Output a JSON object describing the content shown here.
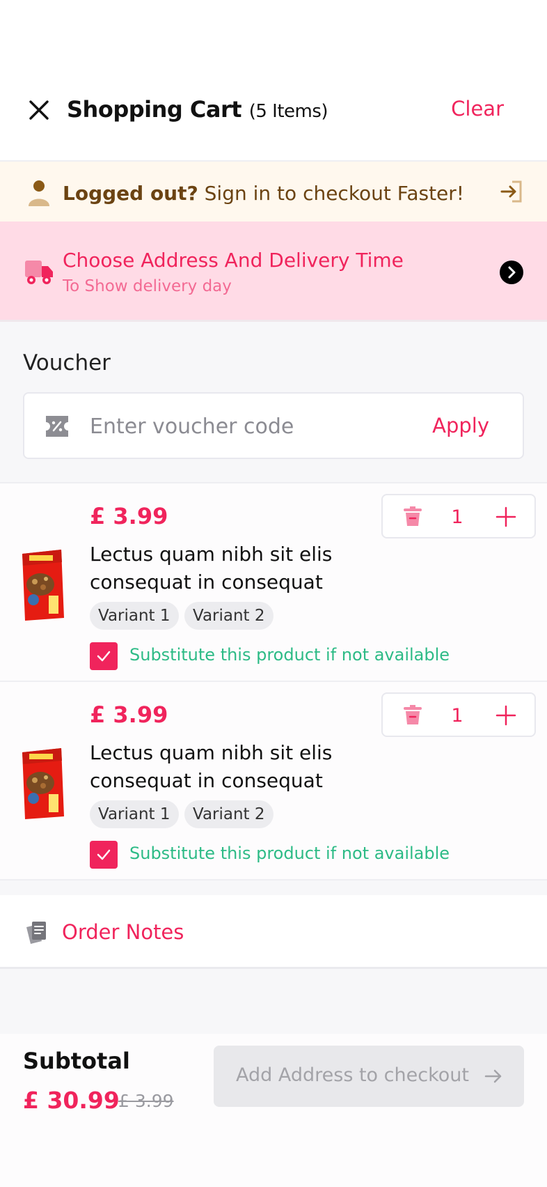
{
  "header": {
    "title": "Shopping Cart",
    "count": "(5 Items)",
    "clear_label": "Clear"
  },
  "login_banner": {
    "bold_text": "Logged out?",
    "text": "Sign in to checkout Faster!"
  },
  "delivery_banner": {
    "title": "Choose Address And Delivery Time",
    "subtitle": "To Show delivery day"
  },
  "voucher": {
    "label": "Voucher",
    "placeholder": "Enter voucher code",
    "apply_label": "Apply"
  },
  "items": [
    {
      "price": "£ 3.99",
      "name": "Lectus quam nibh sit elis consequat in consequat",
      "variants": [
        "Variant 1",
        "Variant 2"
      ],
      "quantity": "1",
      "substitute_label": "Substitute this product if not available",
      "substitute_checked": true
    },
    {
      "price": "£ 3.99",
      "name": "Lectus quam nibh sit elis consequat in consequat",
      "variants": [
        "Variant 1",
        "Variant 2"
      ],
      "quantity": "1",
      "substitute_label": "Substitute this product if not available",
      "substitute_checked": true
    }
  ],
  "notes": {
    "label": "Order Notes"
  },
  "footer": {
    "subtotal_label": "Subtotal",
    "subtotal_price": "£ 30.99",
    "old_price": "£ 3.99",
    "checkout_label": "Add Address to checkout"
  },
  "colors": {
    "accent": "#f0245c",
    "success": "#2dbb86",
    "login_bg": "#fff8ee",
    "delivery_bg": "#ffdbe6"
  },
  "icons": [
    "close-icon",
    "person-icon",
    "sign-in-icon",
    "truck-icon",
    "chevron-right-icon",
    "voucher-icon",
    "trash-icon",
    "plus-icon",
    "check-icon",
    "notes-icon",
    "arrow-right-icon"
  ]
}
